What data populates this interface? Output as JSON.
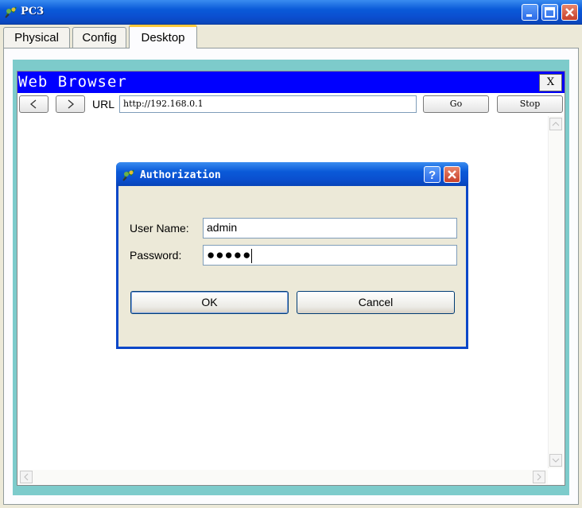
{
  "window": {
    "title": "PC3"
  },
  "tabs": [
    "Physical",
    "Config",
    "Desktop"
  ],
  "active_tab": "Desktop",
  "browser": {
    "title": "Web Browser",
    "close_label": "X",
    "back_label": "<",
    "forward_label": ">",
    "url_label": "URL",
    "url_value": "http://192.168.0.1",
    "go_label": "Go",
    "stop_label": "Stop"
  },
  "dialog": {
    "title": "Authorization",
    "username_label": "User Name:",
    "username_value": "admin",
    "password_label": "Password:",
    "password_mask": "●●●●●",
    "ok_label": "OK",
    "cancel_label": "Cancel"
  },
  "colors": {
    "title_bar_blue": "#0a5ad8",
    "browser_title_blue": "#0000ff",
    "panel_teal": "#7dcbcb",
    "active_tab_highlight": "#ffc83c"
  }
}
